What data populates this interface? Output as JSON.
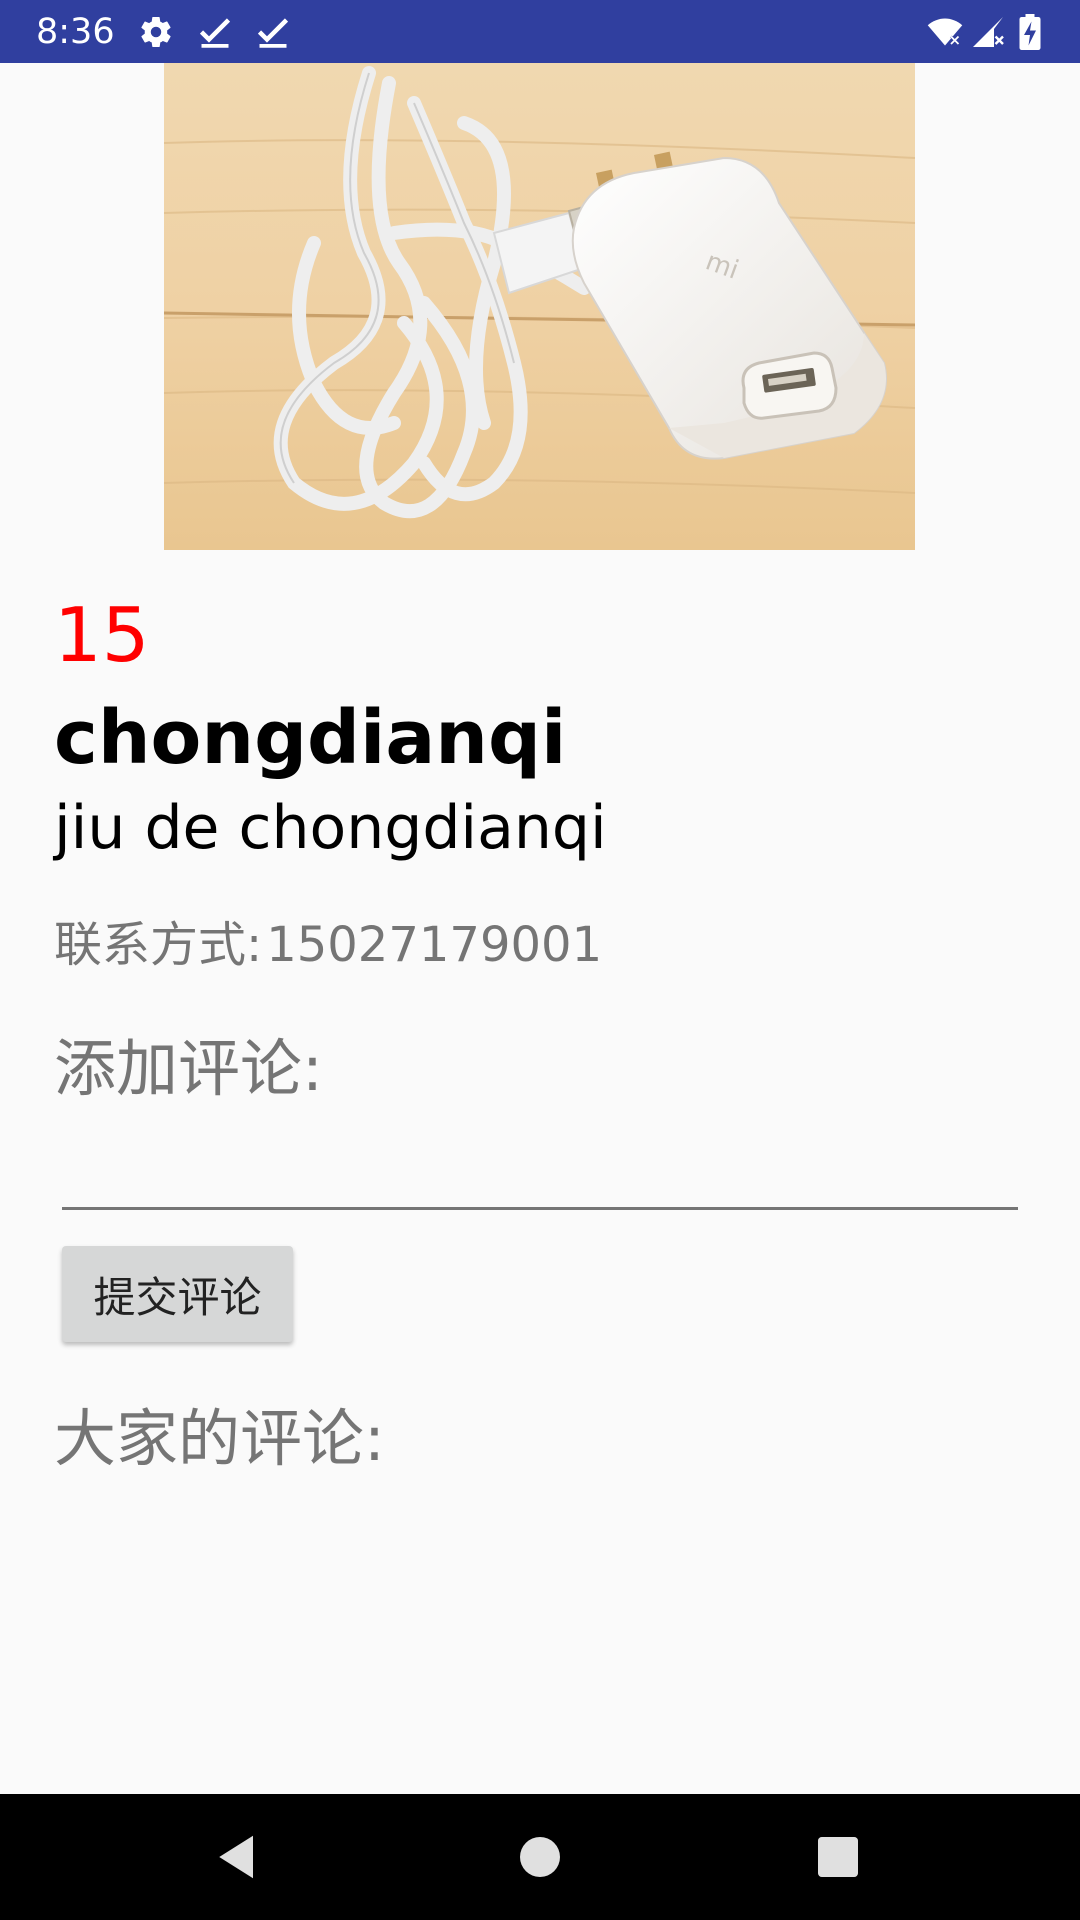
{
  "status_bar": {
    "time": "8:36",
    "left_icons": [
      "gear-icon",
      "check-icon",
      "check-icon"
    ],
    "right_icons": [
      "wifi-icon",
      "signal-icon",
      "battery-charging-icon"
    ],
    "background": "#303f9f"
  },
  "product": {
    "image": "usb-charger-photo",
    "price": "15",
    "price_color": "#ff0000",
    "title": "chongdianqi",
    "description": "jiu de chongdianqi",
    "contact_label": "联系方式:",
    "contact_value": "15027179001"
  },
  "comment_form": {
    "label": "添加评论:",
    "input_value": "",
    "submit_label": "提交评论"
  },
  "comments": {
    "label": "大家的评论:",
    "items": []
  },
  "nav_bar": {
    "buttons": [
      "back-icon",
      "home-icon",
      "recents-icon"
    ]
  }
}
